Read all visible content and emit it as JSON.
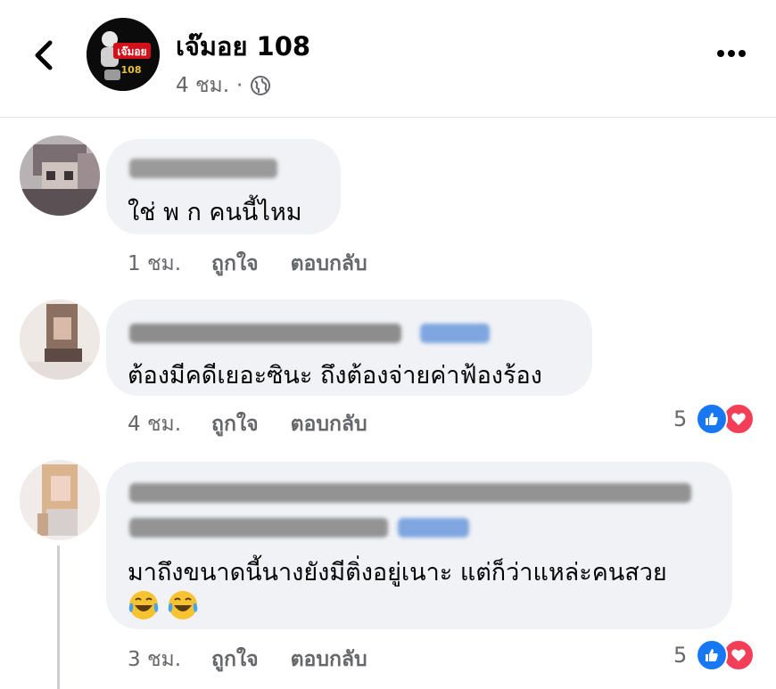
{
  "header": {
    "page_name": "เจ๊มอย 108",
    "time": "4 ชม.",
    "separator": "·",
    "avatar_text": "เจ๊มอย",
    "avatar_num": "108"
  },
  "comments": [
    {
      "text": "ใช่ พ ก  คนนี้ไหม",
      "time": "1 ชม.",
      "like_label": "ถูกใจ",
      "reply_label": "ตอบกลับ",
      "reaction_count": ""
    },
    {
      "text": "ต้องมีคดีเยอะซินะ ถึงต้องจ่ายค่าฟ้องร้อง",
      "time": "4 ชม.",
      "like_label": "ถูกใจ",
      "reply_label": "ตอบกลับ",
      "reaction_count": "5"
    },
    {
      "text": "มาถึงขนาดนี้นางยังมีติ่งอยู่เนาะ แต่ก็ว่าแหล่ะคนสวย",
      "emoji": "😂😂",
      "time": "3 ชม.",
      "like_label": "ถูกใจ",
      "reply_label": "ตอบกลับ",
      "reaction_count": "5"
    }
  ],
  "colors": {
    "bubble": "#f0f2f5",
    "meta": "#65676b",
    "like_blue": "#1877f2",
    "love_red": "#f33e58"
  }
}
